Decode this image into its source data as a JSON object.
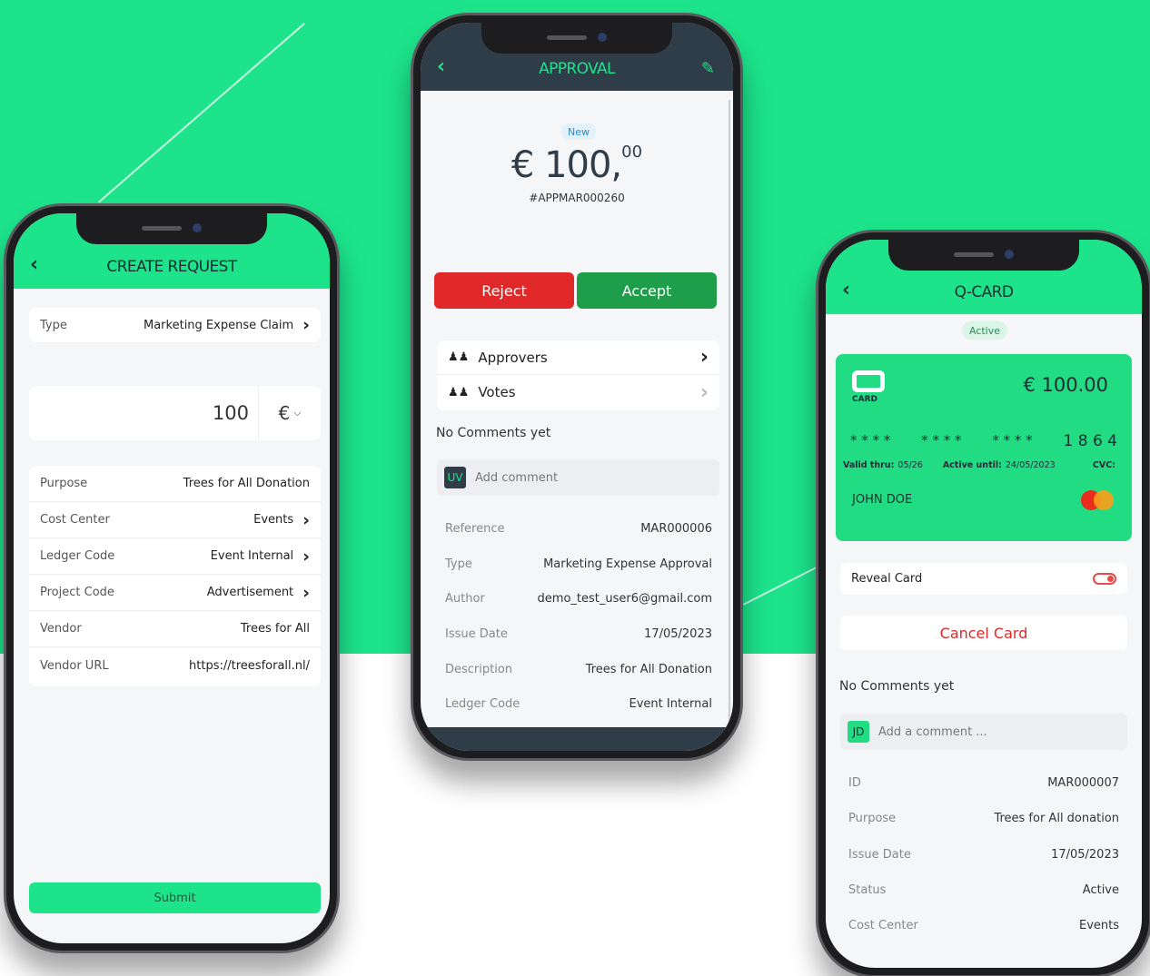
{
  "create_request": {
    "title": "CREATE REQUEST",
    "type_label": "Type",
    "type_value": "Marketing Expense Claim",
    "amount": "100",
    "currency": "€",
    "rows": [
      {
        "label": "Purpose",
        "value": "Trees for All Donation",
        "chevron": false
      },
      {
        "label": "Cost Center",
        "value": "Events",
        "chevron": true
      },
      {
        "label": "Ledger Code",
        "value": "Event Internal",
        "chevron": true
      },
      {
        "label": "Project Code",
        "value": "Advertisement",
        "chevron": true
      },
      {
        "label": "Vendor",
        "value": "Trees for All",
        "chevron": false
      },
      {
        "label": "Vendor URL",
        "value": "https://treesforall.nl/",
        "chevron": false
      }
    ],
    "submit_label": "Submit"
  },
  "approval": {
    "title": "APPROVAL",
    "badge": "New",
    "amount_main": "€ 100,",
    "amount_cents": "00",
    "reference_code": "#APPMAR000260",
    "reject_label": "Reject",
    "accept_label": "Accept",
    "approvers_label": "Approvers",
    "votes_label": "Votes",
    "no_comments": "No Comments yet",
    "avatar_initials": "UV",
    "comment_placeholder": "Add comment",
    "details": [
      {
        "label": "Reference",
        "value": "MAR000006"
      },
      {
        "label": "Type",
        "value": "Marketing Expense Approval"
      },
      {
        "label": "Author",
        "value": "demo_test_user6@gmail.com"
      },
      {
        "label": "Issue Date",
        "value": "17/05/2023"
      },
      {
        "label": "Description",
        "value": "Trees for All Donation"
      },
      {
        "label": "Ledger Code",
        "value": "Event Internal"
      }
    ]
  },
  "qcard": {
    "title": "Q-CARD",
    "status_badge": "Active",
    "logo_text": "CARD",
    "balance": "€ 100.00",
    "mask_groups": [
      "* * * *",
      "* * * *",
      "* * * *"
    ],
    "last_digits": "1 8 6 4",
    "valid_label": "Valid thru:",
    "valid_value": "05/26",
    "active_label": "Active until:",
    "active_value": "24/05/2023",
    "cvc_label": "CVC:",
    "holder": "JOHN DOE",
    "reveal_label": "Reveal Card",
    "cancel_label": "Cancel Card",
    "no_comments": "No Comments yet",
    "avatar_initials": "JD",
    "comment_placeholder": "Add a comment ...",
    "details": [
      {
        "label": "ID",
        "value": "MAR000007"
      },
      {
        "label": "Purpose",
        "value": "Trees for All donation"
      },
      {
        "label": "Issue Date",
        "value": "17/05/2023"
      },
      {
        "label": "Status",
        "value": "Active"
      },
      {
        "label": "Cost Center",
        "value": "Events"
      }
    ]
  },
  "colors": {
    "brand_green": "#1de48b",
    "dark_header": "#2e3d47",
    "reject_red": "#e02828",
    "accept_green": "#1e9e4a"
  },
  "icons": [
    "back-chevron-icon",
    "edit-pencil-icon",
    "chevron-right-icon",
    "people-icon",
    "toggle-icon",
    "mastercard-logo-icon",
    "card-logo-icon"
  ]
}
